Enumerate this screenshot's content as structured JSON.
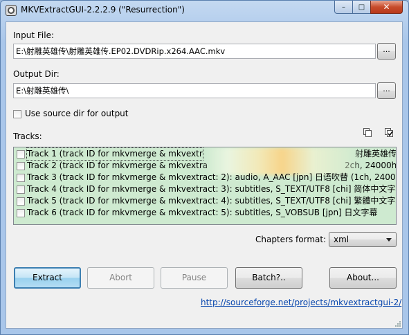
{
  "window": {
    "title": "MKVExtractGUI-2.2.2.9 (\"Resurrection\")",
    "minimize_glyph": "–",
    "maximize_glyph": "□",
    "close_glyph": "✕"
  },
  "input_file": {
    "label": "Input File:",
    "value": "E:\\射雕英雄传\\射雕英雄传.EP02.DVDRip.x264.AAC.mkv",
    "browse_label": "..."
  },
  "output_dir": {
    "label": "Output Dir:",
    "value": "E:\\射雕英雄传\\",
    "browse_label": "..."
  },
  "use_source_dir": {
    "label": "Use source dir for output",
    "checked": false
  },
  "tracks": {
    "label": "Tracks:",
    "icons": [
      "copy-icon",
      "select-all-icon"
    ],
    "items": [
      {
        "text": "Track 1 (track ID for mkvmerge & mkvextr",
        "tail": "射雕英雄传",
        "checked": false
      },
      {
        "text": "Track 2 (track ID for mkvmerge & mkvextra",
        "tail": "2ch, 24000hz)",
        "checked": false
      },
      {
        "text": "Track 3 (track ID for mkvmerge & mkvextract: 2): audio, A_AAC [jpn] 日语吹替 (1ch, 24000hz)",
        "tail": "",
        "checked": false
      },
      {
        "text": "Track 4 (track ID for mkvmerge & mkvextract: 3): subtitles, S_TEXT/UTF8 [chi] 简体中文字幕",
        "tail": "",
        "checked": false
      },
      {
        "text": "Track 5 (track ID for mkvmerge & mkvextract: 4): subtitles, S_TEXT/UTF8 [chi] 繁體中文字幕",
        "tail": "",
        "checked": false
      },
      {
        "text": "Track 6 (track ID for mkvmerge & mkvextract: 5): subtitles, S_VOBSUB [jpn] 日文字幕",
        "tail": "",
        "checked": false
      }
    ]
  },
  "chapters": {
    "label": "Chapters format:",
    "selected": "xml"
  },
  "buttons": {
    "extract": "Extract",
    "abort": "Abort",
    "pause": "Pause",
    "batch": "Batch?..",
    "about": "About..."
  },
  "link": {
    "text": "http://sourceforge.net/projects/mkvextractgui-2/"
  }
}
